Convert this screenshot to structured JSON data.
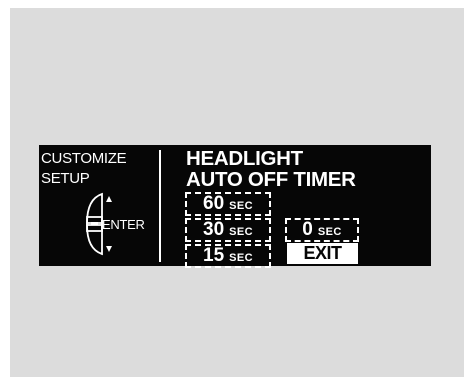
{
  "setup_screen": {
    "left_title": [
      "CUSTOMIZE",
      "SETUP"
    ],
    "knob": {
      "enter_label": "ENTER"
    },
    "heading": [
      "HEADLIGHT",
      "AUTO OFF TIMER"
    ],
    "options": [
      {
        "value": "60",
        "unit": "SEC"
      },
      {
        "value": "30",
        "unit": "SEC"
      },
      {
        "value": "15",
        "unit": "SEC"
      },
      {
        "value": "0",
        "unit": "SEC"
      }
    ],
    "exit_label": "EXIT"
  }
}
